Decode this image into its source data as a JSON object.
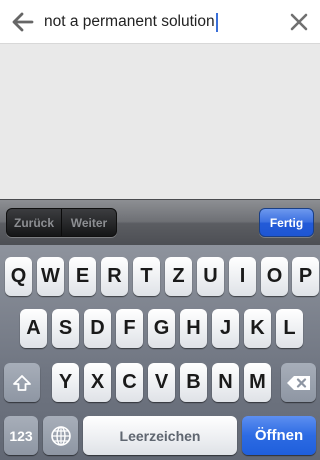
{
  "search": {
    "value": "not a permanent solution",
    "back_icon": "arrow-left-icon",
    "clear_icon": "close-icon"
  },
  "accessory": {
    "prev_label": "Zurück",
    "next_label": "Weiter",
    "done_label": "Fertig"
  },
  "keyboard": {
    "row1": [
      "Q",
      "W",
      "E",
      "R",
      "T",
      "Z",
      "U",
      "I",
      "O",
      "P"
    ],
    "row2": [
      "A",
      "S",
      "D",
      "F",
      "G",
      "H",
      "J",
      "K",
      "L"
    ],
    "row3": [
      "Y",
      "X",
      "C",
      "V",
      "B",
      "N",
      "M"
    ],
    "numbers_label": "123",
    "space_label": "Leerzeichen",
    "go_label": "Öffnen",
    "shift_icon": "shift-icon",
    "globe_icon": "globe-icon",
    "backspace_icon": "backspace-icon"
  },
  "colors": {
    "accent": "#2d6be3",
    "caret": "#3a6fd8"
  }
}
